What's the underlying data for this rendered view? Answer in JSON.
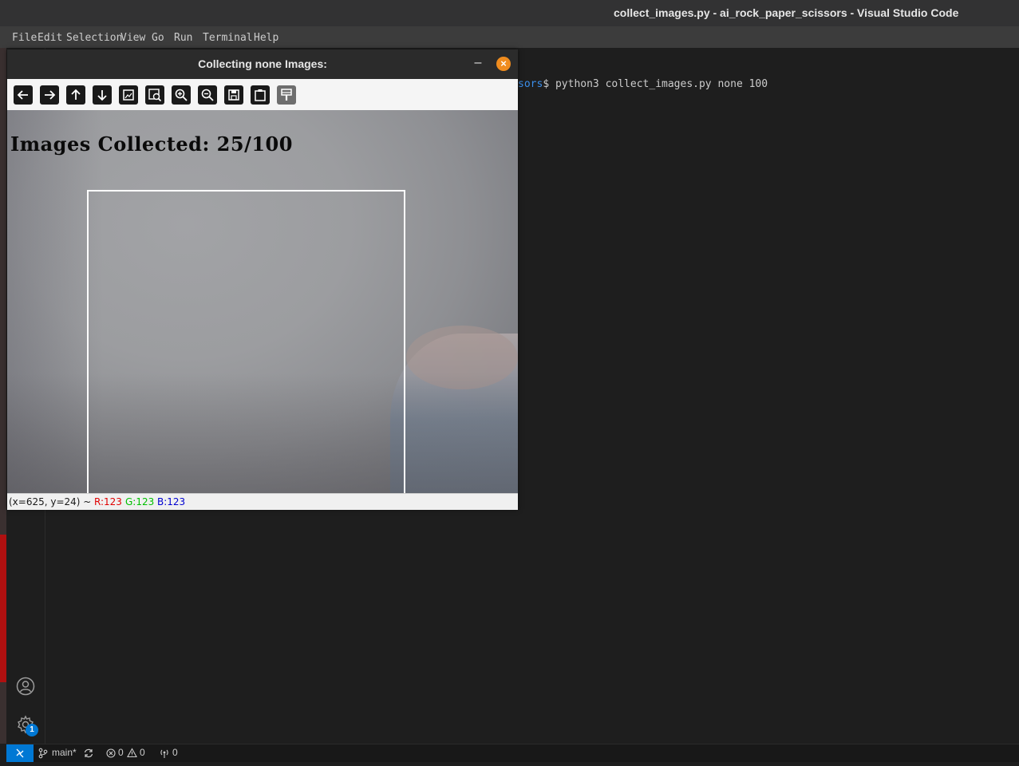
{
  "window": {
    "title": "collect_images.py - ai_rock_paper_scissors - Visual Studio Code"
  },
  "menu": [
    "File",
    "Edit",
    "Selection",
    "View",
    "Go",
    "Run",
    "Terminal",
    "Help"
  ],
  "terminal": {
    "path_fragment": "sors",
    "command": "$ python3 collect_images.py none 100"
  },
  "activitybar": {
    "account_icon": "account-icon",
    "settings_icon": "gear-icon",
    "settings_badge": "1"
  },
  "statusbar": {
    "remote_icon": "remote-icon",
    "branch": "main*",
    "errors": "0",
    "warnings": "0",
    "ports": "0"
  },
  "cv_window": {
    "title": "Collecting none Images:",
    "minimize": "–",
    "close": "×",
    "toolbar": [
      "pan-left-icon",
      "pan-right-icon",
      "pan-up-icon",
      "pan-down-icon",
      "zoom-fit-icon",
      "zoom-actual-icon",
      "zoom-in-icon",
      "zoom-out-icon",
      "save-icon",
      "copy-icon",
      "properties-icon"
    ],
    "overlay_text": "Images Collected: 25/100",
    "status": {
      "coords": "(x=625, y=24) ~",
      "r": "R:123",
      "g": "G:123",
      "b": "B:123"
    },
    "colors": {
      "r": "#e00000",
      "g": "#00c000",
      "b": "#0000d0",
      "close_button": "#f08c1e"
    }
  }
}
